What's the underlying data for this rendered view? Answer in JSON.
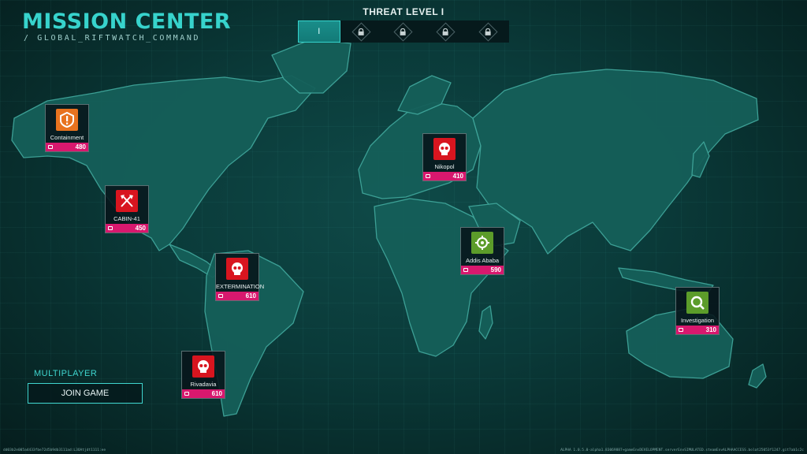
{
  "header": {
    "title": "MISSION CENTER",
    "subtitle": "/ GLOBAL_RIFTWATCH_COMMAND"
  },
  "threat": {
    "title": "THREAT LEVEL I",
    "levels": [
      {
        "label": "I",
        "state": "active"
      },
      {
        "label": "",
        "state": "locked"
      },
      {
        "label": "",
        "state": "locked"
      },
      {
        "label": "",
        "state": "locked"
      },
      {
        "label": "",
        "state": "locked"
      }
    ]
  },
  "missions": [
    {
      "name": "Containment",
      "reward": "480",
      "icon": "alert-shield-icon",
      "color": "#e8731f"
    },
    {
      "name": "CABIN-41",
      "reward": "450",
      "icon": "crossed-axes-icon",
      "color": "#d8151f"
    },
    {
      "name": "EXTERMINATION",
      "reward": "610",
      "icon": "skull-icon",
      "color": "#d8151f"
    },
    {
      "name": "Rivadavia",
      "reward": "610",
      "icon": "skull-icon",
      "color": "#d8151f"
    },
    {
      "name": "Nikopol",
      "reward": "410",
      "icon": "skull-icon",
      "color": "#d8151f"
    },
    {
      "name": "Addis Ababa",
      "reward": "590",
      "icon": "crosshair-icon",
      "color": "#5c9c2a"
    },
    {
      "name": "Investigation",
      "reward": "310",
      "icon": "magnifier-icon",
      "color": "#5c9c2a"
    }
  ],
  "multiplayer": {
    "label": "MULTIPLAYER",
    "join_label": "JOIN GAME"
  },
  "footer": {
    "left": "dd03b2e005a4433fbe72d5b9db3111ad:L3OAtjdt1111:ee",
    "right": "ALPHA 1.0.5.0-alpha1.83069887+gameEnvDEVELOPMENT.serverEnvSIMULATED.steamEnvALPHAACCESS.bolat25053f1247.git7ab1c2c"
  },
  "colors": {
    "accent": "#37d3cc",
    "reward": "#d8186e",
    "hostile": "#d8151f",
    "orange": "#e8731f",
    "green": "#5c9c2a"
  }
}
